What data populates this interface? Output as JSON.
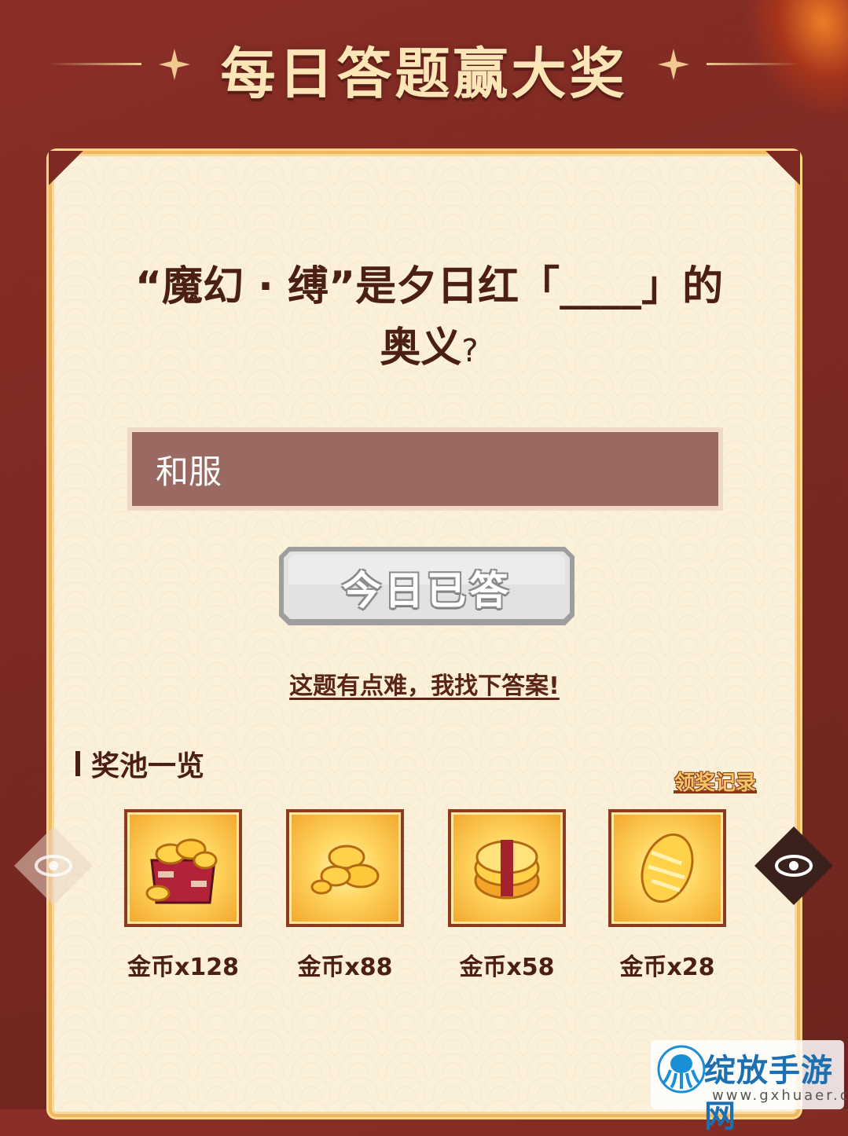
{
  "header": {
    "title": "每日答题赢大奖"
  },
  "quiz": {
    "question": "“魔幻 · 缚”是夕日红「____」的奥义",
    "question_mark": "?",
    "answer_value": "和服",
    "submit_label": "今日已答",
    "hint_link": "这题有点难，我找下答案!"
  },
  "pool": {
    "title": "奖池一览",
    "record_link": "领奖记录",
    "rewards": [
      {
        "label": "金币x128",
        "icon": "gold-coin-chest-icon"
      },
      {
        "label": "金币x88",
        "icon": "gold-coin-pile-icon"
      },
      {
        "label": "金币x58",
        "icon": "gold-coin-stack-icon"
      },
      {
        "label": "金币x28",
        "icon": "gold-coin-icon"
      }
    ]
  },
  "watermark": {
    "title": "绽放手游网",
    "url": "www.gxhuaer.com"
  },
  "colors": {
    "background": "#7d2a22",
    "card": "#fbf1da",
    "text": "#4b1e16",
    "gold": "#f0b760"
  }
}
